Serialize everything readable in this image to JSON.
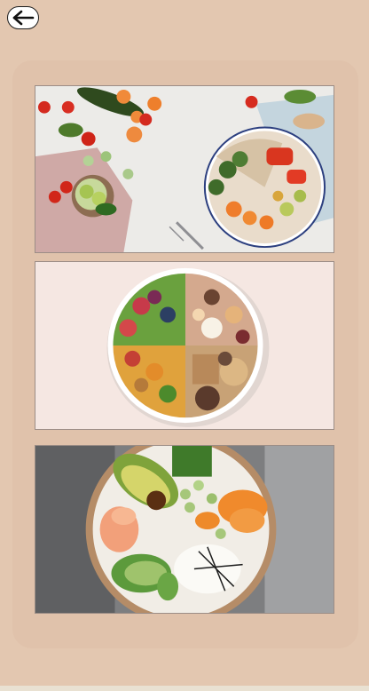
{
  "header": {
    "back_icon": "arrow-left-icon"
  },
  "gallery": {
    "images": [
      {
        "name": "vegetables-bowl-photo",
        "description_icon": "food-photo"
      },
      {
        "name": "healthy-plate-photo",
        "description_icon": "food-photo"
      },
      {
        "name": "poke-bowl-photo",
        "description_icon": "food-photo"
      }
    ]
  },
  "colors": {
    "background": "#e3c7b0",
    "card": "#e0c2ab"
  }
}
